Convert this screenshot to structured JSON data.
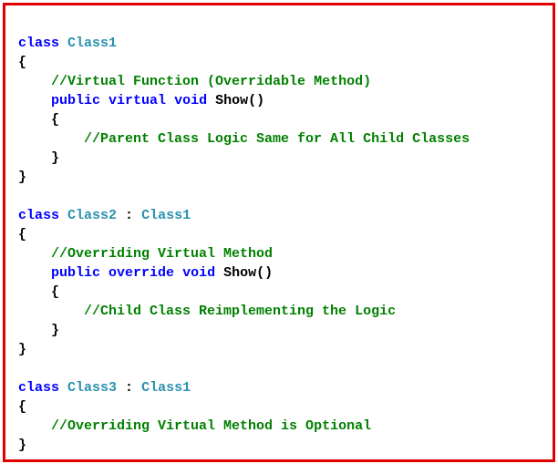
{
  "code": {
    "class1": {
      "kw_class": "class",
      "name": "Class1",
      "open": "{",
      "comment1": "//Virtual Function (Overridable Method)",
      "kw_public": "public",
      "kw_virtual": "virtual",
      "kw_void": "void",
      "method": "Show()",
      "m_open": "{",
      "comment2": "//Parent Class Logic Same for All Child Classes",
      "m_close": "}",
      "close": "}"
    },
    "class2": {
      "kw_class": "class",
      "name": "Class2",
      "inherit": " : ",
      "base": "Class1",
      "open": "{",
      "comment1": "//Overriding Virtual Method",
      "kw_public": "public",
      "kw_override": "override",
      "kw_void": "void",
      "method": "Show()",
      "m_open": "{",
      "comment2": "//Child Class Reimplementing the Logic",
      "m_close": "}",
      "close": "}"
    },
    "class3": {
      "kw_class": "class",
      "name": "Class3",
      "inherit": " : ",
      "base": "Class1",
      "open": "{",
      "comment1": "//Overriding Virtual Method is Optional",
      "close": "}"
    }
  }
}
